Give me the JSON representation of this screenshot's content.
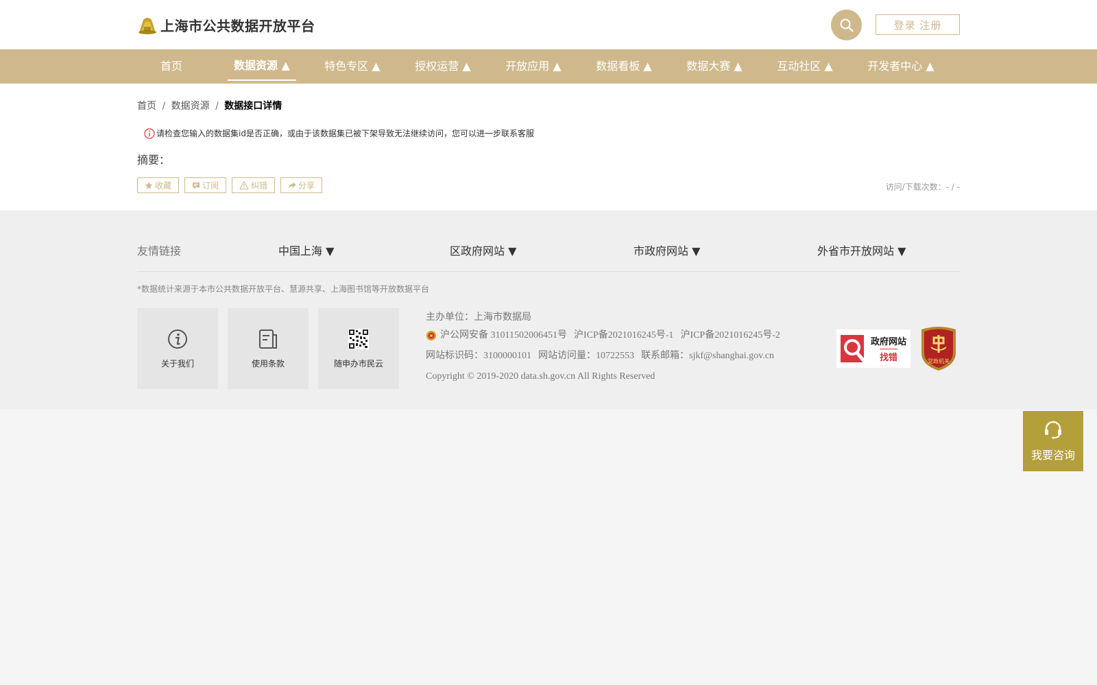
{
  "header": {
    "title": "上海市公共数据开放平台",
    "login_label": "登录 注册"
  },
  "nav": {
    "items": [
      {
        "label": "首页"
      },
      {
        "label": "数据资源 ▲"
      },
      {
        "label": "特色专区 ▲"
      },
      {
        "label": "授权运营 ▲"
      },
      {
        "label": "开放应用 ▲"
      },
      {
        "label": "数据看板 ▲"
      },
      {
        "label": "数据大赛 ▲"
      },
      {
        "label": "互动社区 ▲"
      },
      {
        "label": "开发者中心 ▲"
      }
    ],
    "active_index": 1
  },
  "breadcrumb": {
    "home": "首页",
    "sep": "/",
    "level2": "数据资源",
    "current": "数据接口详情"
  },
  "alert": {
    "message": "请检查您输入的数据集id是否正确，或由于该数据集已被下架导致无法继续访问，您可以进一步联系客服"
  },
  "summary": {
    "label": "摘要："
  },
  "actions": {
    "favorite": "收藏",
    "subscribe": "订阅",
    "report_error": "纠错",
    "share": "分享"
  },
  "stats": {
    "visit_download": "访问/下载次数：- / -"
  },
  "footer": {
    "friend_label": "友情链接",
    "friend_links": [
      "中国上海 ▼",
      "区政府网站 ▼",
      "市政府网站 ▼",
      "外省市开放网站 ▼"
    ],
    "stat_note": "*数据统计来源于本市公共数据开放平台、慧源共享、上海图书馆等开放数据平台",
    "tiles": [
      "关于我们",
      "使用条款",
      "随申办市民云"
    ],
    "host": "主办单位：上海市数据局",
    "security_record": "沪公网安备 31011502006451号",
    "icp1": "沪ICP备2021016245号-1",
    "icp2": "沪ICP备2021016245号-2",
    "site_id": "网站标识码：3100000101",
    "visits": "网站访问量：10722553",
    "email": "联系邮箱：sjkf@shanghai.gov.cn",
    "copyright": "Copyright © 2019-2020 data.sh.gov.cn All Rights Reserved",
    "badge_gov_line1": "政府网站",
    "badge_gov_line2": "找错",
    "badge_party": "党政机关"
  },
  "consult": {
    "label": "我要咨询"
  },
  "colors": {
    "gold": "#cfb98c",
    "consult": "#b3a03b",
    "alert_red": "#d9363e"
  }
}
